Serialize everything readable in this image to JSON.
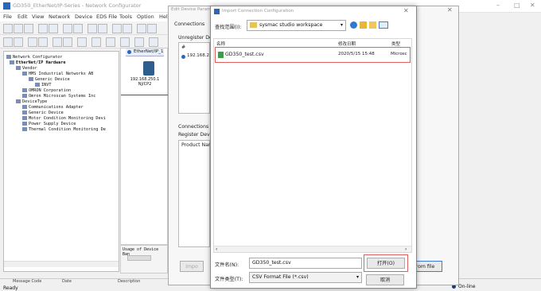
{
  "app": {
    "title": "GD350_EtherNet/IP-Series - Network Configurator",
    "menu": [
      "File",
      "Edit",
      "View",
      "Network",
      "Device",
      "EDS File",
      "Tools",
      "Option",
      "Help"
    ],
    "tree": [
      "Network Configurator",
      "EtherNet/IP Hardware",
      "Vendor",
      "HMS Industrial Networks AB",
      "Generic Device",
      "INVT",
      "OMRON Corporation",
      "Omron Microscan Systems Inc",
      "DeviceType",
      "Communications Adapter",
      "Generic Device",
      "Motor Condition Monitoring Devi",
      "Power Supply Device",
      "Thermal Condition Monitoring De"
    ],
    "network_tab": "EtherNet/IP_1",
    "node_ip": "192.168.250.1",
    "node_name": "NJ/CP2",
    "usage_label": "Usage of Device Ban",
    "status_ready": "Ready",
    "status_online": "On-line",
    "status_labels": [
      "Message Code",
      "Date",
      "Description"
    ]
  },
  "device_panel": {
    "title": "Edit Device Parameters",
    "tab": "Connections",
    "unregister_label": "Unregister De",
    "col_hash": "#",
    "row_ip": "192.168.2",
    "connections_label": "Connections :",
    "register_label": "Register Devic",
    "product_name_label": "Product Nar",
    "from_file_button": "rom file",
    "bottom_button": "Impo"
  },
  "dialog": {
    "title": "Import Connection Configuration",
    "lookin_label": "查找范围(I):",
    "folder": "sysmac studio workspace",
    "columns": [
      "名称",
      "修改日期",
      "类型"
    ],
    "files": [
      {
        "name": "GD350_test.csv",
        "date": "2020/5/15 15:48",
        "type": "Microsc"
      }
    ],
    "filename_label": "文件名(N):",
    "filename_value": "GD350_test.csv",
    "filetype_label": "文件类型(T):",
    "filetype_value": "CSV Format File (*.csv)",
    "open_button": "打开(O)",
    "cancel_button": "取消",
    "close_symbol": "✕"
  },
  "colors": {
    "highlight_border": "#e06060",
    "accent": "#2a67b8"
  }
}
